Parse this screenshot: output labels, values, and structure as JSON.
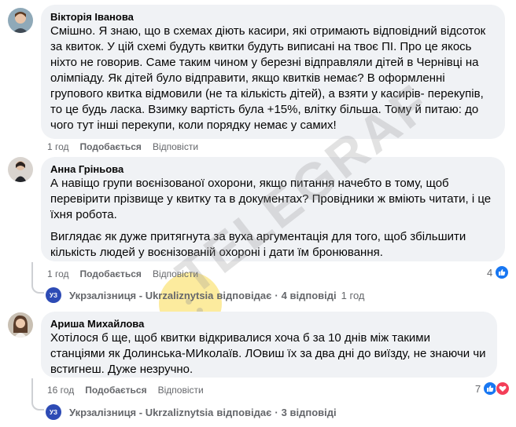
{
  "comments": [
    {
      "author": "Вікторія Іванова",
      "paragraphs": [
        "Смішно. Я знаю, що в схемах діють касири, які отримають відповідний відсоток за квиток. У цій схемі будуть квитки будуть виписані на твоє ПІ. Про це якось ніхто не говорив. Саме таким чином у березні відправляли дітей в Чернівці на олімпіаду. Як дітей було відправити, якщо квитків немає? В оформленні групового квитка відмовили (не та кількість дітей), а взяти у касирів- перекупів, то це будь ласка. Взимку вартість була +15%, влітку більша. Тому й питаю: до чого тут інші перекупи, коли порядку немає у самих!"
      ],
      "time": "1 год",
      "like_label": "Подобається",
      "reply_label": "Відповісти"
    },
    {
      "author": "Анна Гріньова",
      "paragraphs": [
        "А навіщо групи воєнізованої охорони, якщо питання начебто в тому, щоб перевірити прізвище у квитку та в документах? Провідники ж вміють читати, і це їхня робота.",
        "Виглядає як дуже притягнута за вуха аргументація для того, щоб збільшити кількість людей у воєнізованій охороні і дати їм бронювання."
      ],
      "time": "1 год",
      "like_label": "Подобається",
      "reply_label": "Відповісти",
      "reaction_count": "4",
      "replies": {
        "page_name": "Укрзалізниця - Ukrzaliznytsia",
        "action": "відповідає",
        "count_text": "4 відповіді",
        "time": "1 год"
      }
    },
    {
      "author": "Ариша Михайлова",
      "paragraphs": [
        "Хотілося б ще, щоб квитки відкривалися хоча б за 10 днів між такими станціями як Долинська-МИколаїв. ЛОвиш їх за два дні до виїзду, не знаючи чи встигнеш. Дуже незручно."
      ],
      "time": "16 год",
      "like_label": "Подобається",
      "reply_label": "Відповісти",
      "reaction_count": "7",
      "replies": {
        "page_name": "Укрзалізниця - Ukrzaliznytsia",
        "action": "відповідає",
        "count_text": "3 відповіді"
      }
    }
  ],
  "uz_logo_text": "УЗ",
  "watermark": "TELEGRAF"
}
